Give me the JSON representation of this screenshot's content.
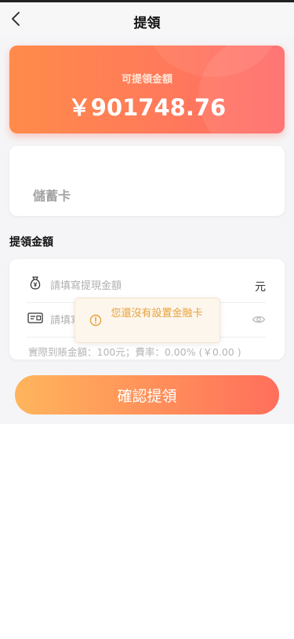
{
  "header": {
    "title": "提領"
  },
  "balance": {
    "label": "可提領金額",
    "amount": "￥901748.76"
  },
  "card": {
    "name": "儲蓄卡"
  },
  "section": {
    "title": "提領金額"
  },
  "form": {
    "amount_placeholder": "請填寫提現金額",
    "amount_unit": "元",
    "password_placeholder": "請填寫提現密碼",
    "summary": "實際到賬金額：100元；費率：0.00% (￥0.00 )"
  },
  "toast": {
    "message": "您還沒有設置金融卡"
  },
  "actions": {
    "confirm_label": "確認提領"
  },
  "colors": {
    "accent": "#ff7a5a",
    "warning": "#e6a23c"
  }
}
